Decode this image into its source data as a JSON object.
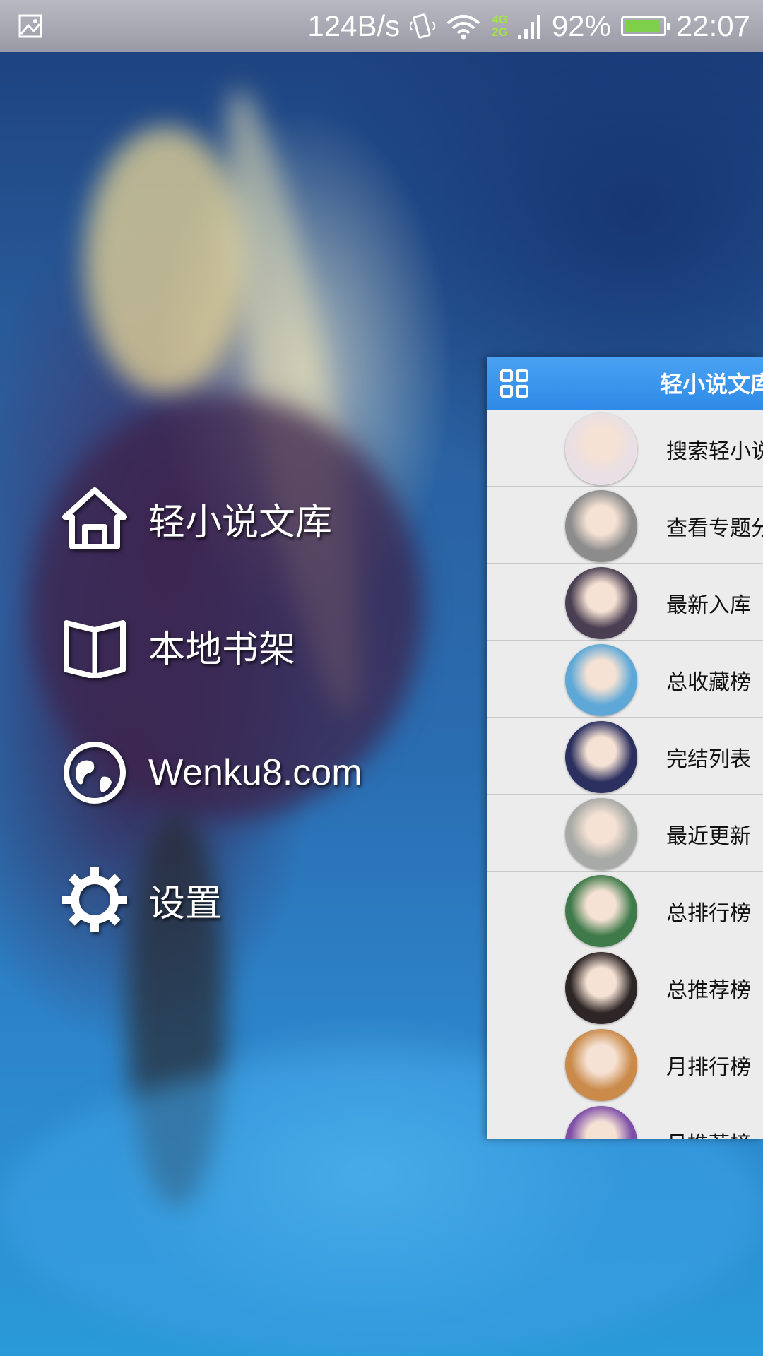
{
  "status_bar": {
    "speed": "124B/s",
    "net_type_top": "4G",
    "net_type_bottom": "2G",
    "battery": "92%",
    "battery_level": 0.92,
    "time": "22:07",
    "icons": [
      "image-notification-icon",
      "vibrate-icon",
      "wifi-icon",
      "signal-icon",
      "battery-charging-icon"
    ]
  },
  "drawer": {
    "items": [
      {
        "label": "轻小说文库",
        "icon": "home-icon"
      },
      {
        "label": "本地书架",
        "icon": "open-book-icon"
      },
      {
        "label": "Wenku8.com",
        "icon": "globe-icon"
      },
      {
        "label": "设置",
        "icon": "gear-icon"
      }
    ]
  },
  "panel": {
    "title": "轻小说文库",
    "menu_icon": "grid-menu-icon",
    "list": [
      {
        "label": "搜索轻小说",
        "color": "#e9dfe4"
      },
      {
        "label": "查看专题分类",
        "color": "#8c8c8c"
      },
      {
        "label": "最新入库",
        "color": "#4a3f52"
      },
      {
        "label": "总收藏榜",
        "color": "#5ea8d8"
      },
      {
        "label": "完结列表",
        "color": "#2c3060"
      },
      {
        "label": "最近更新",
        "color": "#a7aaa6"
      },
      {
        "label": "总排行榜",
        "color": "#3f7a4a"
      },
      {
        "label": "总推荐榜",
        "color": "#2e2626"
      },
      {
        "label": "月排行榜",
        "color": "#c98a4a"
      },
      {
        "label": "月推荐榜",
        "color": "#7e4fa8"
      }
    ]
  }
}
